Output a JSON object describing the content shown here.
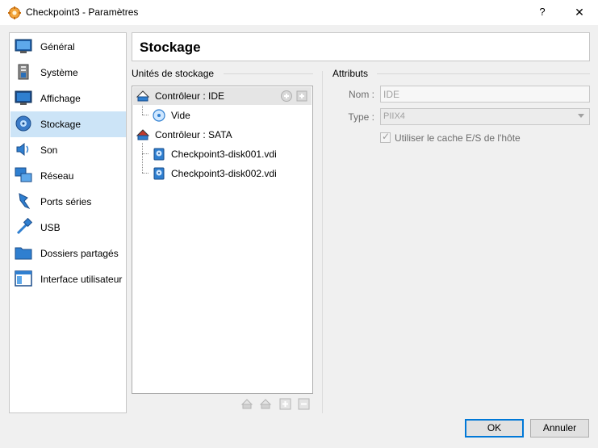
{
  "window": {
    "title": "Checkpoint3 - Paramètres",
    "help_label": "?",
    "close_label": "✕"
  },
  "nav": {
    "items": [
      {
        "label": "Général",
        "icon": "general-icon"
      },
      {
        "label": "Système",
        "icon": "system-icon"
      },
      {
        "label": "Affichage",
        "icon": "display-icon"
      },
      {
        "label": "Stockage",
        "icon": "storage-icon",
        "selected": true
      },
      {
        "label": "Son",
        "icon": "audio-icon"
      },
      {
        "label": "Réseau",
        "icon": "network-icon"
      },
      {
        "label": "Ports séries",
        "icon": "serial-ports-icon"
      },
      {
        "label": "USB",
        "icon": "usb-icon"
      },
      {
        "label": "Dossiers partagés",
        "icon": "shared-folders-icon"
      },
      {
        "label": "Interface utilisateur",
        "icon": "user-interface-icon"
      }
    ]
  },
  "page": {
    "heading": "Stockage"
  },
  "storage": {
    "group_title": "Unités de stockage",
    "tree": [
      {
        "label": "Contrôleur : IDE",
        "type": "controller-ide",
        "selected": true
      },
      {
        "label": "Vide",
        "type": "optical-empty"
      },
      {
        "label": "Contrôleur : SATA",
        "type": "controller-sata"
      },
      {
        "label": "Checkpoint3-disk001.vdi",
        "type": "hard-disk"
      },
      {
        "label": "Checkpoint3-disk002.vdi",
        "type": "hard-disk"
      }
    ]
  },
  "attributes": {
    "group_title": "Attributs",
    "name_label": "Nom :",
    "name_value": "IDE",
    "type_label": "Type :",
    "type_value": "PIIX4",
    "cache_label": "Utiliser le cache E/S de l'hôte",
    "cache_checked": true
  },
  "buttons": {
    "ok": "OK",
    "cancel": "Annuler"
  },
  "colors": {
    "selection": "#cce4f7",
    "accent": "#0078d7",
    "icon_blue": "#1f6fbf"
  }
}
